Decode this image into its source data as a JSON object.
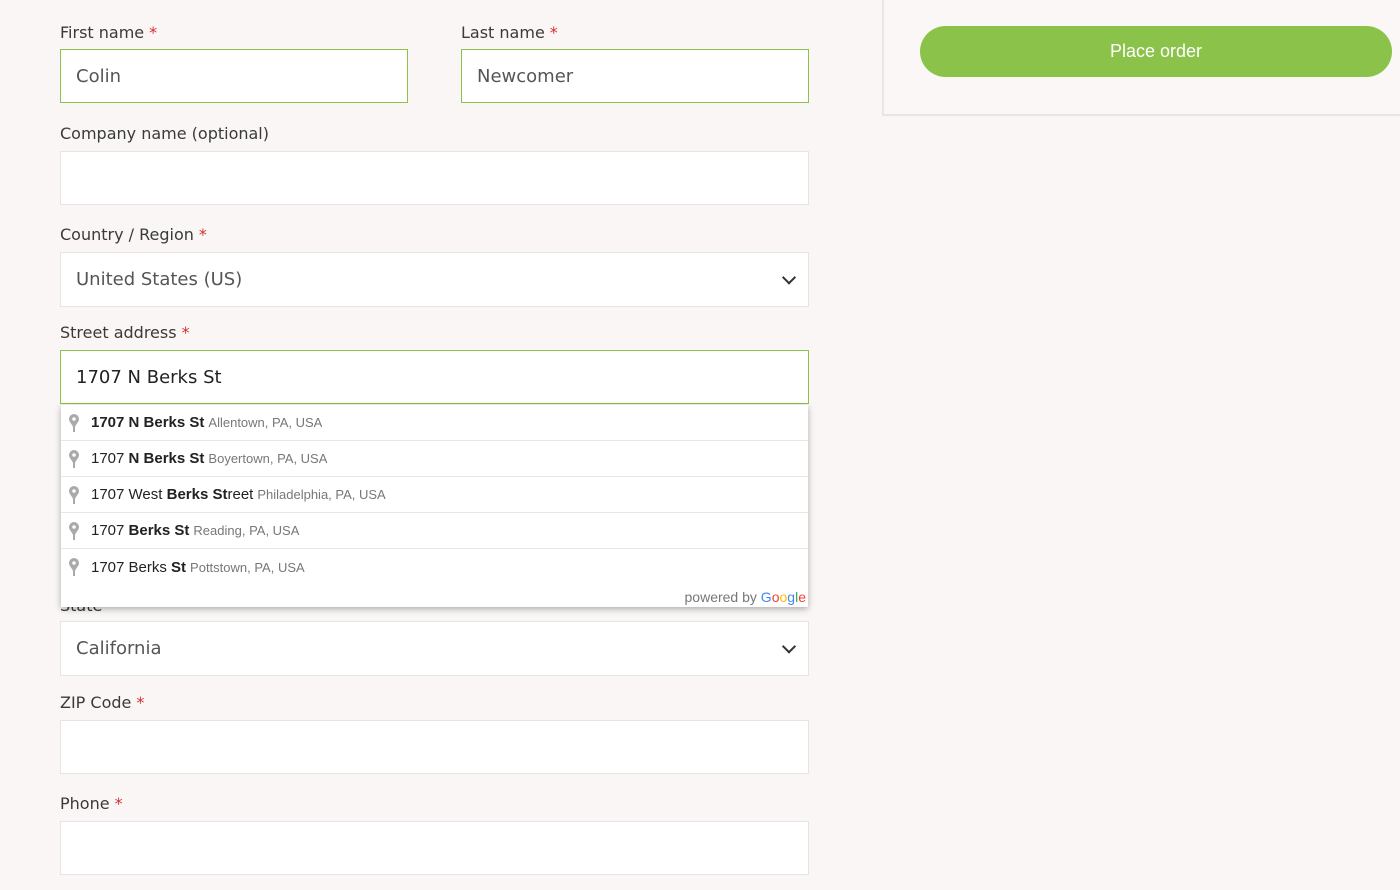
{
  "form": {
    "first_name": {
      "label": "First name",
      "required": "*",
      "value": "Colin"
    },
    "last_name": {
      "label": "Last name",
      "required": "*",
      "value": "Newcomer"
    },
    "company": {
      "label": "Company name (optional)",
      "value": ""
    },
    "country": {
      "label": "Country / Region",
      "required": "*",
      "value": "United States (US)"
    },
    "street": {
      "label": "Street address",
      "required": "*",
      "value": "1707 N Berks St"
    },
    "state": {
      "label": "State",
      "value": "California"
    },
    "zip": {
      "label": "ZIP Code",
      "required": "*",
      "value": ""
    },
    "phone": {
      "label": "Phone",
      "required": "*",
      "value": ""
    }
  },
  "autocomplete": {
    "suggestions": [
      {
        "main": [
          {
            "text": "1707 N Berks St",
            "bold": true
          }
        ],
        "secondary": "Allentown, PA, USA"
      },
      {
        "main": [
          {
            "text": "1707 ",
            "bold": false
          },
          {
            "text": "N Berks St",
            "bold": true
          }
        ],
        "secondary": "Boyertown, PA, USA"
      },
      {
        "main": [
          {
            "text": "1707 West ",
            "bold": false
          },
          {
            "text": "Berks St",
            "bold": true
          },
          {
            "text": "reet",
            "bold": false
          }
        ],
        "secondary": "Philadelphia, PA, USA"
      },
      {
        "main": [
          {
            "text": "1707 ",
            "bold": false
          },
          {
            "text": "Berks St",
            "bold": true
          }
        ],
        "secondary": "Reading, PA, USA"
      },
      {
        "main": [
          {
            "text": "1707 Berks ",
            "bold": false
          },
          {
            "text": "St",
            "bold": true
          }
        ],
        "secondary": "Pottstown, PA, USA"
      }
    ],
    "powered_by": "powered by",
    "brand": "Google",
    "icon": "map-pin-icon"
  },
  "order": {
    "place_order_label": "Place order"
  },
  "colors": {
    "accent": "#8bc34a",
    "required": "#d32f2f",
    "background": "#f9f6f5"
  }
}
